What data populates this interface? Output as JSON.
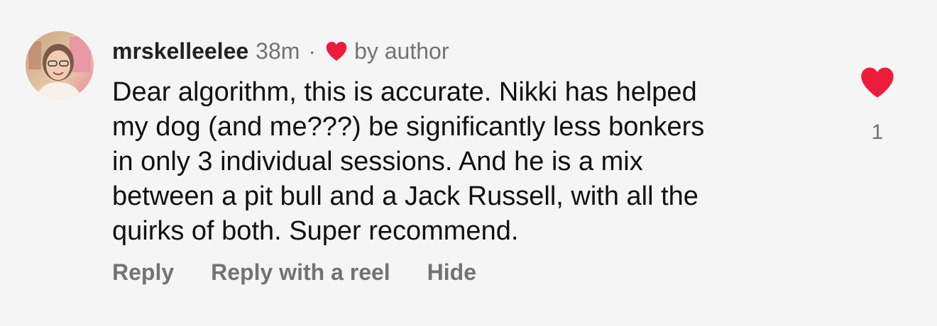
{
  "comment": {
    "username": "mrskelleelee",
    "time": "38m",
    "separator": "·",
    "liked_by_author_icon": "heart-icon",
    "by_author_label": "by author",
    "text": "Dear algorithm, this is accurate. Nikki has helped\nmy dog (and me???) be significantly less bonkers\nin only 3 individual sessions. And he is a mix\nbetween a pit bull and a Jack Russell, with all the\nquirks of both. Super recommend.",
    "actions": {
      "reply": "Reply",
      "reply_with_reel": "Reply with a reel",
      "hide": "Hide"
    },
    "like": {
      "icon": "heart-icon",
      "count": "1",
      "liked": true
    }
  },
  "colors": {
    "background": "#f5f5f5",
    "heart": "#ed1c3b",
    "secondary_text": "#737373",
    "primary_text": "#111111"
  }
}
